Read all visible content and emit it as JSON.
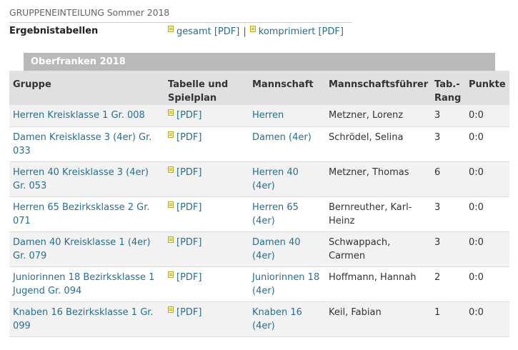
{
  "section_title": "GRUPPENEINTEILUNG Sommer 2018",
  "results": {
    "label": "Ergebnistabellen",
    "link_gesamt": "gesamt [PDF]",
    "separator": "|",
    "link_komprimiert": "komprimiert [PDF]"
  },
  "region": {
    "title": "Oberfranken 2018"
  },
  "table": {
    "headers": {
      "gruppe": "Gruppe",
      "tabelle": "Tabelle und Spielplan",
      "mannschaft": "Mannschaft",
      "fuehrer": "Mannschaftsführer",
      "rang": "Tab.-Rang",
      "punkte": "Punkte"
    },
    "rows": [
      {
        "gruppe": "Herren Kreisklasse 1 Gr. 008",
        "pdf": "[PDF]",
        "mannschaft": "Herren",
        "fuehrer": "Metzner, Lorenz",
        "rang": "3",
        "punkte": "0:0"
      },
      {
        "gruppe": "Damen Kreisklasse 3 (4er) Gr. 033",
        "pdf": "[PDF]",
        "mannschaft": "Damen (4er)",
        "fuehrer": "Schrödel, Selina",
        "rang": "3",
        "punkte": "0:0"
      },
      {
        "gruppe": "Herren 40 Kreisklasse 3 (4er) Gr. 053",
        "pdf": "[PDF]",
        "mannschaft": "Herren 40 (4er)",
        "fuehrer": "Metzner, Thomas",
        "rang": "6",
        "punkte": "0:0"
      },
      {
        "gruppe": "Herren 65 Bezirksklasse 2 Gr. 071",
        "pdf": "[PDF]",
        "mannschaft": "Herren 65 (4er)",
        "fuehrer": "Bernreuther, Karl-Heinz",
        "rang": "3",
        "punkte": "0:0"
      },
      {
        "gruppe": "Damen 40 Kreisklasse 1 (4er) Gr. 079",
        "pdf": "[PDF]",
        "mannschaft": "Damen 40 (4er)",
        "fuehrer": "Schwappach, Carmen",
        "rang": "3",
        "punkte": "0:0"
      },
      {
        "gruppe": "Juniorinnen 18 Bezirksklasse 1 Jugend Gr. 094",
        "pdf": "[PDF]",
        "mannschaft": "Juniorinnen 18 (4er)",
        "fuehrer": "Hoffmann, Hannah",
        "rang": "2",
        "punkte": "0:0"
      },
      {
        "gruppe": "Knaben 16 Bezirksklasse 1 Gr. 099",
        "pdf": "[PDF]",
        "mannschaft": "Knaben 16 (4er)",
        "fuehrer": "Keil, Fabian",
        "rang": "1",
        "punkte": "0:0"
      }
    ]
  },
  "icons": {
    "pdf": "pdf-file-icon"
  },
  "colors": {
    "link": "#2a6e8f",
    "region_header_bg": "#b9b9b9",
    "table_header_bg": "#e0e0e0",
    "row_alt_bg": "#f2f2f2"
  }
}
